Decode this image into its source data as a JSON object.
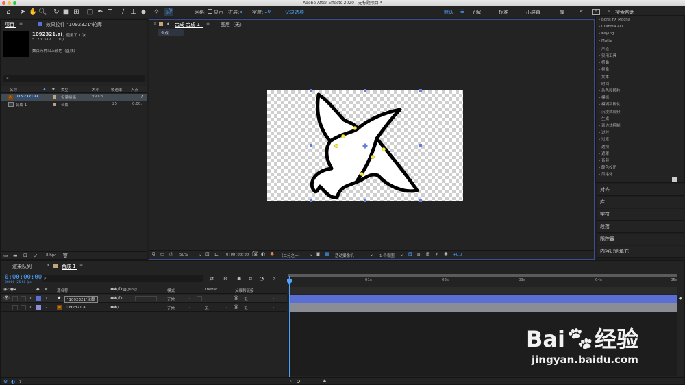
{
  "window": {
    "title": "Adobe After Effects 2020 - 无标题项目 *"
  },
  "toolbar": {
    "grid_label": "网格:",
    "show_label": "显示",
    "expand_label": "扩展:",
    "expand_value": "3",
    "density_label": "密度:",
    "density_value": "10",
    "record_label": "记录选项",
    "workspaces": [
      "默认",
      "了解",
      "标准",
      "小屏幕",
      "库"
    ],
    "search_placeholder": "搜索帮助"
  },
  "project_panel": {
    "tab_project": "项目",
    "tab_effects": "效果控件 \"1092321\"轮廓",
    "item_name": "1092321.ai",
    "item_used": "，使用了 1 次",
    "item_dims": "512 x 512 (1.00)",
    "item_color": "数百万种以上颜色（直线）",
    "columns": [
      "名称",
      "类型",
      "大小",
      "帧速率",
      "入点"
    ],
    "rows": [
      {
        "name": "1092321.ai",
        "type": "矢量插画",
        "size": "39 KB",
        "fps": "",
        "in": ""
      },
      {
        "name": "合成 1",
        "type": "合成",
        "size": "",
        "fps": "25",
        "in": "0:00:"
      }
    ],
    "bpc": "8 bpc"
  },
  "comp_panel": {
    "tab_comp": "合成 合成 1",
    "tab_layer": "图层（无）",
    "flow_label": "合成 1",
    "zoom": "50%",
    "timecode": "0:00:00:00",
    "resolution": "（二分之一）",
    "camera": "活动摄像机",
    "views": "1 个视图",
    "exposure": "+0.0"
  },
  "effects_list": [
    "Boris FX Mocha",
    "CINEMA 4D",
    "Keying",
    "Matte",
    "声道",
    "实用工具",
    "扭曲",
    "抠像",
    "文本",
    "时间",
    "杂色和颗粒",
    "模拟",
    "模糊和锐化",
    "沉浸式视频",
    "生成",
    "表达式控制",
    "过时",
    "过渡",
    "透视",
    "遮罩",
    "音频",
    "颜色校正",
    "风格化"
  ],
  "side_panels": [
    "对齐",
    "库",
    "字符",
    "段落",
    "跟踪器",
    "内容识别填充"
  ],
  "timeline": {
    "tab_render": "渲染队列",
    "tab_comp": "合成 1",
    "timecode": "0:00:00:00",
    "timecode_sub": "00000 (25.00 fps)",
    "col_source": "源名称",
    "col_mode": "模式",
    "col_t": "T",
    "col_trkmat": "TrkMat",
    "col_parent": "父级和链接",
    "layers": [
      {
        "num": "1",
        "name": "\"1092321\"轮廓",
        "mode": "正常",
        "trkmat": "",
        "parent": "无"
      },
      {
        "num": "2",
        "name": "1092321.ai",
        "mode": "正常",
        "trkmat": "无",
        "parent": "无"
      }
    ],
    "ruler": [
      "0s",
      "01s",
      "02s",
      "03s",
      "04s",
      "05s"
    ]
  },
  "watermark": {
    "brand": "Bai",
    "brand2": "经验",
    "url": "jingyan.baidu.com"
  },
  "colors": {
    "accent": "#4da3ff",
    "layer_bar": "#5a6fd3",
    "layer_bar2": "#8a8d96",
    "handle": "#6a7fd6"
  }
}
